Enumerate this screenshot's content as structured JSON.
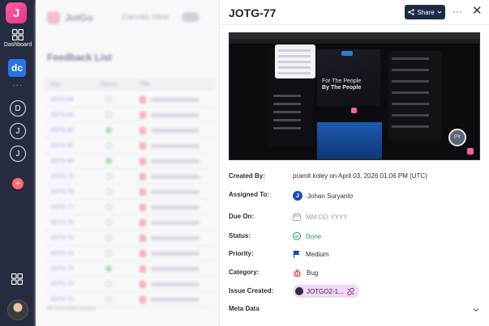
{
  "rail": {
    "logo_letter": "J",
    "dashboard_label": "Dashboard",
    "active_app": "dc",
    "more_dots": "···",
    "circle_items": [
      "D",
      "J",
      "J"
    ],
    "add_symbol": "+"
  },
  "background": {
    "app_name": "JotGo",
    "canvas_view_label": "Canvas View",
    "page_title": "Feedback List",
    "columns": [
      "Key",
      "Status",
      "Title"
    ],
    "rows": [
      {
        "key": "JOTG-84",
        "status": "open"
      },
      {
        "key": "JOTG-83",
        "status": "open"
      },
      {
        "key": "JOTG-82",
        "status": "done"
      },
      {
        "key": "JOTG-81",
        "status": "open"
      },
      {
        "key": "JOTG-80",
        "status": "done"
      },
      {
        "key": "JOTG-79",
        "status": "open"
      },
      {
        "key": "JOTG-78",
        "status": "open"
      },
      {
        "key": "JOTG-77",
        "status": "open"
      },
      {
        "key": "JOTG-76",
        "status": "open"
      },
      {
        "key": "JOTG-75",
        "status": "open"
      },
      {
        "key": "JOTG-74",
        "status": "open"
      },
      {
        "key": "JOTG-73",
        "status": "done"
      },
      {
        "key": "JOTG-72",
        "status": "open"
      },
      {
        "key": "JOTG-71",
        "status": "open"
      }
    ],
    "footer": "84 recorded issues"
  },
  "panel": {
    "title": "JOTG-77",
    "share_label": "Share",
    "more_label": "···",
    "close_label": "✕",
    "screenshot": {
      "headline_1": "For The People",
      "headline_2": "By The People",
      "avatar_initials": "PY"
    },
    "fields": {
      "created_by": {
        "label": "Created By:",
        "value": "pramit koley on April 03, 2026 01:06 PM (UTC)"
      },
      "assigned_to": {
        "label": "Assigned To:",
        "value": "Johan Suryanto",
        "avatar": "J"
      },
      "due_on": {
        "label": "Due On:",
        "value": "MM-DD-YYYY"
      },
      "status": {
        "label": "Status:",
        "value": "Done"
      },
      "priority": {
        "label": "Priority:",
        "value": "Medium"
      },
      "category": {
        "label": "Category:",
        "value": "Bug"
      },
      "issue_created": {
        "label": "Issue Created:",
        "value": "JOTGO2-1..."
      }
    },
    "meta_label": "Meta Data"
  },
  "colors": {
    "rail_bg": "#262b40",
    "accent_pink": "#e8338a",
    "share_bg": "#1f2b45",
    "status_done": "#1f9d55",
    "priority_flag": "#1e3fbf",
    "bug_red": "#d93b3b",
    "chip_bg": "#f3d7f3"
  },
  "icons": {
    "share": "share-icon",
    "calendar": "calendar-icon",
    "status": "check-circle-icon",
    "priority": "flag-icon",
    "category": "bug-icon",
    "unlink": "unlink-icon",
    "meta": "chevron-down-icon"
  }
}
